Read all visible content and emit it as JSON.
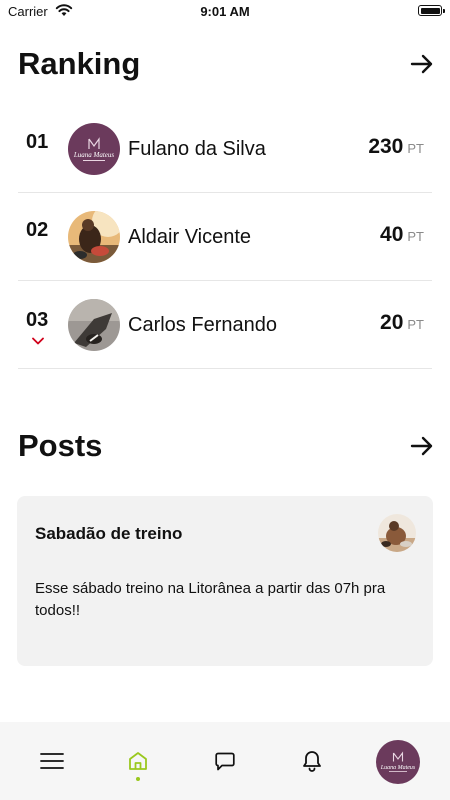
{
  "status_bar": {
    "carrier": "Carrier",
    "time": "9:01 AM"
  },
  "ranking": {
    "title": "Ranking",
    "items": [
      {
        "position": "01",
        "name": "Fulano da Silva",
        "points": "230",
        "unit": "PT",
        "avatar": "logo-avatar",
        "logo_text": "Luana Mateus"
      },
      {
        "position": "02",
        "name": "Aldair Vicente",
        "points": "40",
        "unit": "PT",
        "avatar": "photo-avatar"
      },
      {
        "position": "03",
        "name": "Carlos Fernando",
        "points": "20",
        "unit": "PT",
        "avatar": "photo-avatar",
        "trend": "down"
      }
    ]
  },
  "posts": {
    "title": "Posts",
    "items": [
      {
        "title": "Sabadão de treino",
        "body": "Esse sábado treino na Litorânea a partir das 07h pra todos!!"
      }
    ]
  },
  "tab_bar": {
    "items": [
      "menu-icon",
      "home-icon",
      "chat-icon",
      "bell-icon",
      "profile-avatar"
    ],
    "active": "home-icon",
    "profile_logo_text": "Luana Mateus"
  },
  "colors": {
    "accent": "#9ac81e",
    "logo_purple": "#6b3a5c",
    "trend_down": "#d0021b",
    "card_bg": "#f2f2f2"
  }
}
